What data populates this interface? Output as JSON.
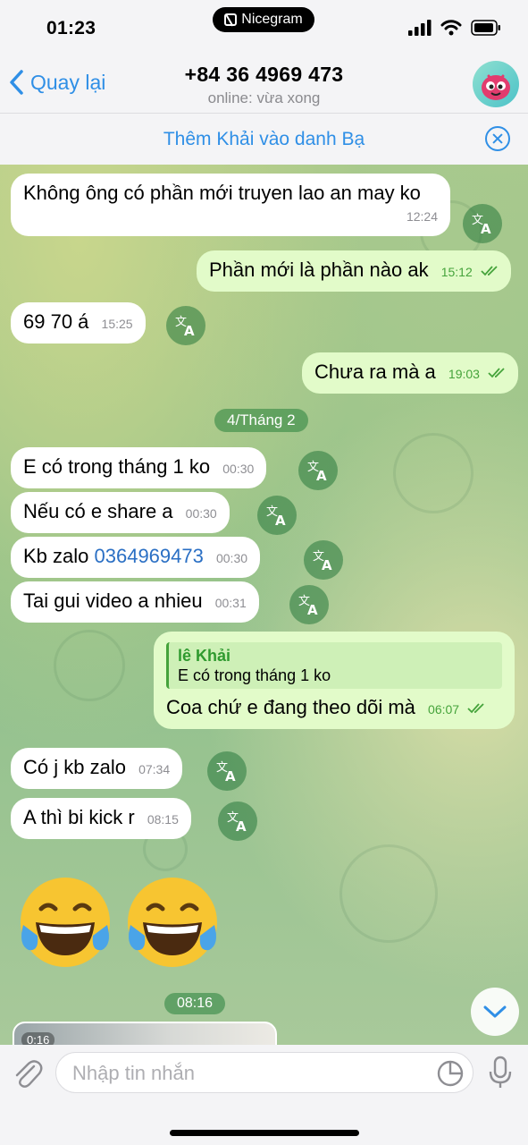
{
  "status": {
    "time": "01:23",
    "pill_label": "Nicegram"
  },
  "header": {
    "back_label": "Quay lại",
    "title": "+84 36 4969 473",
    "subtitle": "online: vừa xong"
  },
  "add_contact": {
    "label": "Thêm Khải vào danh Bạ"
  },
  "messages": [
    {
      "dir": "in",
      "text": "Không ông có phần mới truyen lao an may ko",
      "time": "12:24"
    },
    {
      "dir": "out",
      "text": "Phần mới là phần nào ak",
      "time": "15:12"
    },
    {
      "dir": "in",
      "text": "69 70 á",
      "time": "15:25"
    },
    {
      "dir": "out",
      "text": "Chưa ra mà a",
      "time": "19:03"
    },
    {
      "dir": "in",
      "text": "E có trong tháng 1 ko",
      "time": "00:30"
    },
    {
      "dir": "in",
      "text": "Nếu có e share a",
      "time": "00:30"
    },
    {
      "dir": "in",
      "text_prefix": "Kb zalo ",
      "link": "0364969473",
      "time": "00:30"
    },
    {
      "dir": "in",
      "text": "Tai gui video a nhieu",
      "time": "00:31"
    },
    {
      "dir": "out",
      "reply_name": "lê Khải",
      "reply_text": "E có trong tháng 1 ko",
      "text": "Coa chứ e đang theo dõi mà",
      "time": "06:07"
    },
    {
      "dir": "in",
      "text": "Có j kb zalo",
      "time": "07:34"
    },
    {
      "dir": "in",
      "text": "A thì bi kick r",
      "time": "08:15"
    }
  ],
  "date_separator": "4/Tháng 2",
  "emoji_time": "08:16",
  "video": {
    "duration": "0:16"
  },
  "input": {
    "placeholder": "Nhập tin nhắn"
  },
  "colors": {
    "accent": "#2f8fe6",
    "outgoing_bubble": "#e2fbc9",
    "check": "#45a33b"
  },
  "icons": [
    "chevron-left-icon",
    "close-circle-icon",
    "translate-icon",
    "double-check-icon",
    "chevron-down-icon",
    "paperclip-icon",
    "sticker-icon",
    "microphone-icon"
  ]
}
